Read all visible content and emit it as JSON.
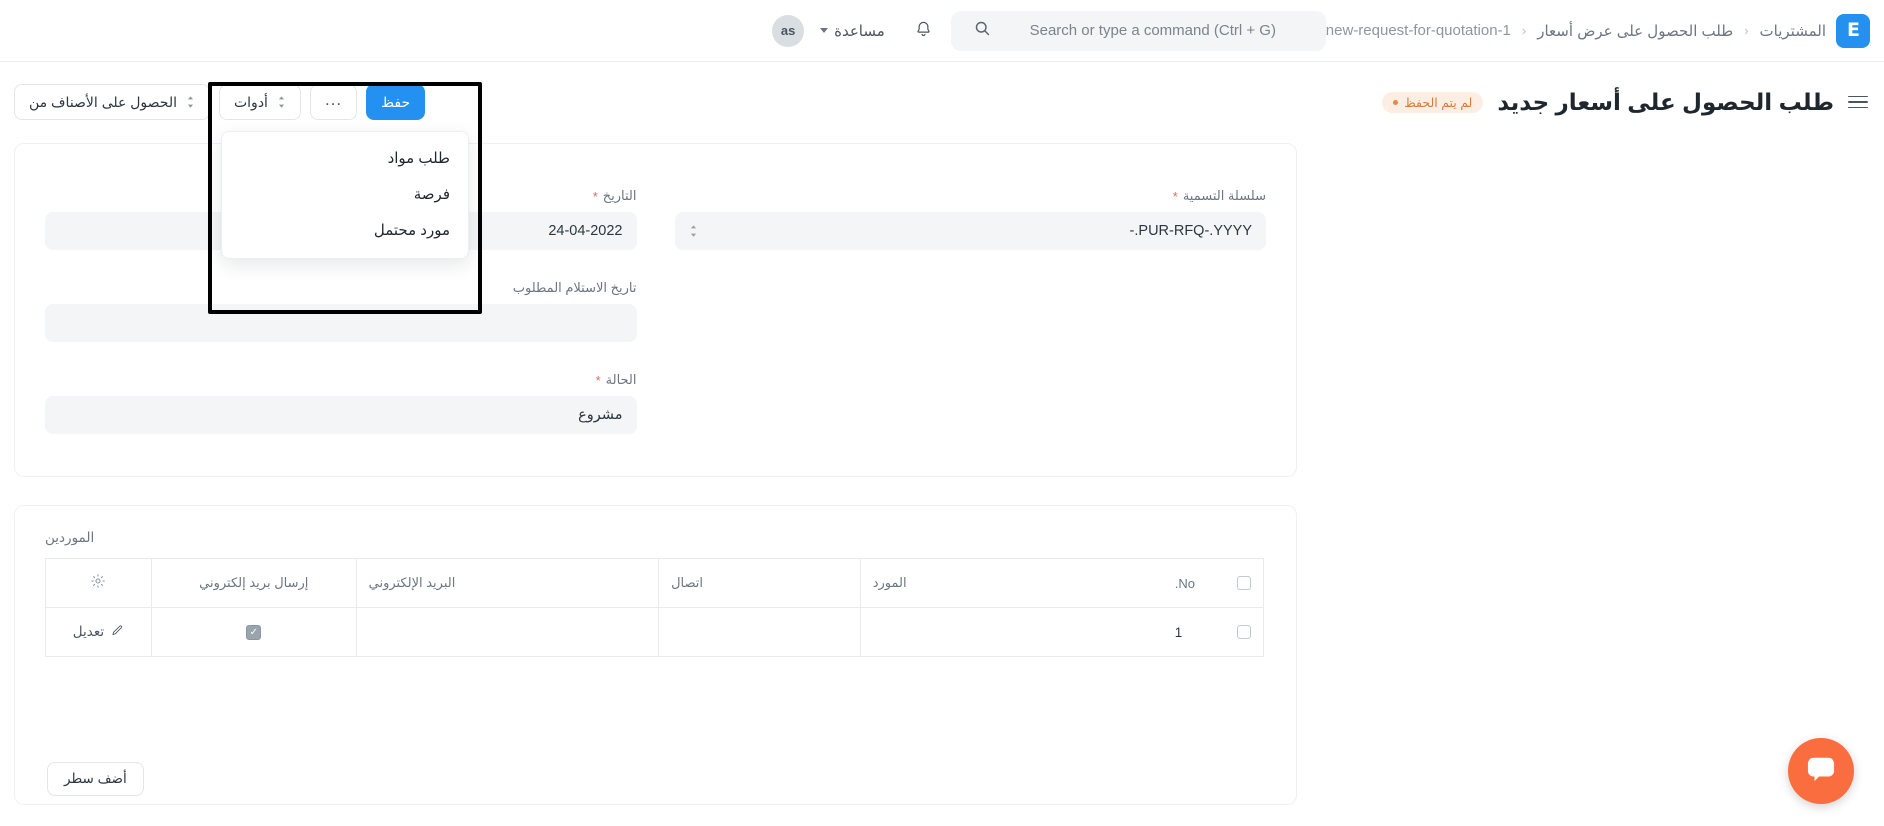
{
  "navbar": {
    "avatar_initials": "as",
    "help_label": "مساعدة",
    "bell_icon": "bell-icon",
    "search_placeholder": "Search or type a command (Ctrl + G)",
    "search_value": "",
    "search_icon": "search-icon",
    "logo_glyph": "E",
    "breadcrumbs": [
      {
        "label": "المشتريات"
      },
      {
        "label": "طلب الحصول على عرض أسعار"
      },
      {
        "label": "new-request-for-quotation-1"
      }
    ],
    "separator": "‹"
  },
  "toolbar": {
    "menu_icon": "list-menu-icon",
    "page_title": "طلب الحصول على أسعار جديد",
    "status_badge": "لم يتم الحفظ",
    "save_label": "حفظ",
    "more_label": "...",
    "tools_label": "أدوات",
    "get_items_label": "الحصول على الأصناف من"
  },
  "dropdown": {
    "items": [
      {
        "label": "طلب مواد"
      },
      {
        "label": "فرصة"
      },
      {
        "label": "مورد محتمل"
      }
    ]
  },
  "form": {
    "naming_series": {
      "label": "سلسلة التسمية",
      "required": "*",
      "value": "PUR-RFQ-.YYYY.-"
    },
    "transaction_date": {
      "label": "التاريخ",
      "required": "*",
      "value": "24-04-2022"
    },
    "schedule_date": {
      "label": "تاريخ الاستلام المطلوب",
      "required": "",
      "value": ""
    },
    "status": {
      "label": "الحالة",
      "required": "*",
      "value": "مشروع"
    }
  },
  "suppliers": {
    "section_title": "الموردين",
    "columns": {
      "no": "No.",
      "supplier": "المورد",
      "contact": "اتصال",
      "email": "البريد الإلكتروني",
      "send_email": "إرسال بريد إلكتروني",
      "settings_icon": "gear-icon"
    },
    "rows": [
      {
        "no": "1",
        "supplier": "",
        "contact": "",
        "email": "",
        "send_email_checked": true,
        "edit_label": "تعديل"
      }
    ],
    "add_row_label": "أضف سطر"
  },
  "chat": {
    "icon": "chat-bubble-icon"
  },
  "colors": {
    "accent": "#2490ef",
    "unsaved_bg": "#fdeee3",
    "unsaved_text": "#d97b3a",
    "chat_fab": "#f96d3f"
  }
}
